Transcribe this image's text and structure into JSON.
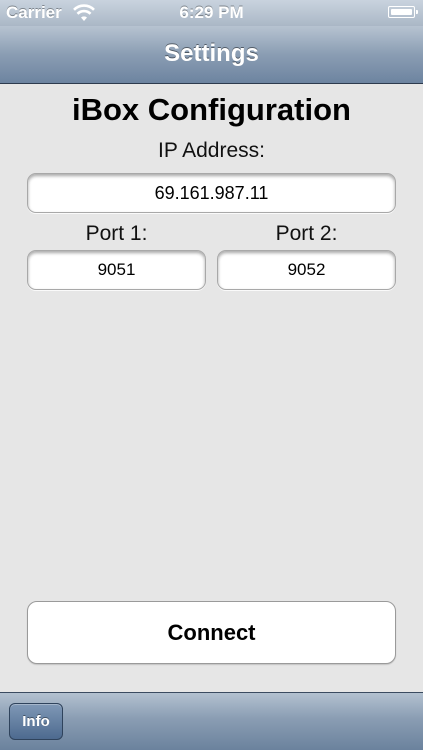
{
  "status_bar": {
    "carrier": "Carrier",
    "time": "6:29 PM",
    "wifi_icon": "wifi-icon",
    "battery_icon": "battery-icon"
  },
  "nav_bar": {
    "title": "Settings"
  },
  "config": {
    "title": "iBox Configuration",
    "ip_label": "IP Address:",
    "ip_value": "69.161.987.11",
    "port1_label": "Port 1:",
    "port1_value": "9051",
    "port2_label": "Port 2:",
    "port2_value": "9052"
  },
  "connect_label": "Connect",
  "toolbar": {
    "info_label": "Info"
  },
  "colors": {
    "background": "#e6e6e6",
    "nav_bar": "#8a9db3",
    "toolbar_button": "#5b789c"
  }
}
